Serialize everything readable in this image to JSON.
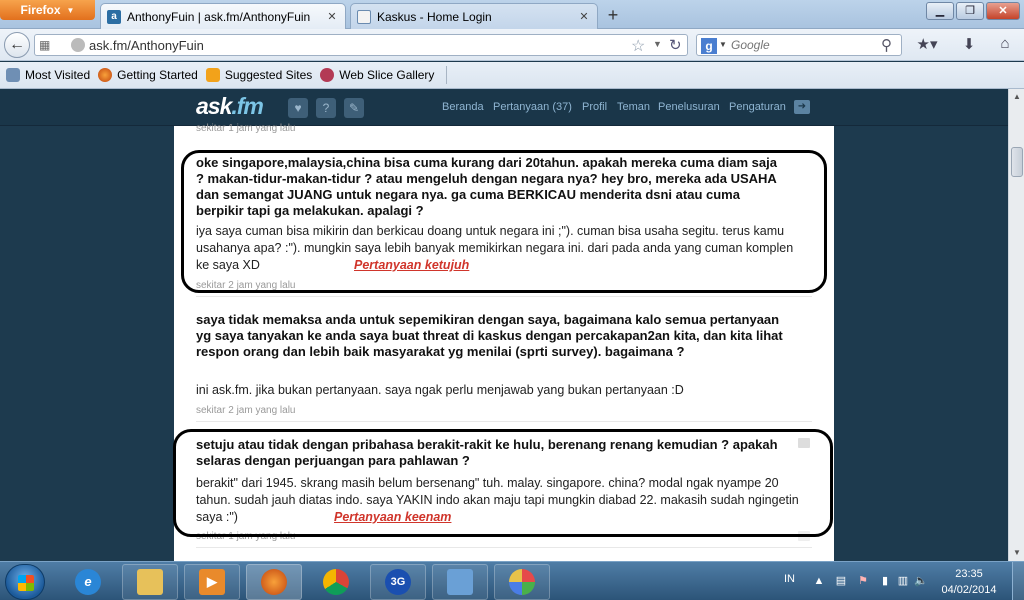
{
  "browser": {
    "menu_button": "Firefox",
    "tabs": [
      {
        "label": "AnthonyFuin | ask.fm/AnthonyFuin",
        "favicon": "askfm-icon",
        "active": true
      },
      {
        "label": "Kaskus - Home Login",
        "favicon": "kaskus-icon",
        "active": false
      }
    ],
    "url": "ask.fm/AnthonyFuin",
    "search_placeholder": "Google",
    "bookmarks": [
      {
        "label": "Most Visited"
      },
      {
        "label": "Getting Started"
      },
      {
        "label": "Suggested Sites"
      },
      {
        "label": "Web Slice Gallery"
      }
    ]
  },
  "askfm": {
    "logo_main": "ask",
    "logo_dot": ".fm",
    "menu": [
      "Beranda",
      "Pertanyaan (37)",
      "Profil",
      "Teman",
      "Penelusuran",
      "Pengaturan"
    ],
    "top_ago": "sekitar 1 jam yang lalu",
    "posts": [
      {
        "question": "oke singapore,malaysia,china bisa cuma kurang dari 20tahun. apakah mereka cuma diam saja ? makan-tidur-makan-tidur ? atau mengeluh dengan negara nya? hey bro, mereka ada USAHA dan semangat JUANG untuk negara nya. ga cuma BERKICAU menderita dsni atau cuma berpikir tapi ga melakukan. apalagi ?",
        "answer": "iya saya cuman bisa mikirin dan berkicau doang untuk negara ini ;\"). cuman bisa usaha segitu. terus kamu usahanya apa? :\"). mungkin saya lebih banyak memikirkan negara ini. dari pada anda yang cuman komplen ke saya XD",
        "ago": "sekitar 2 jam yang lalu",
        "annotation": "Pertanyaan ketujuh"
      },
      {
        "question": "saya tidak memaksa anda untuk sepemikiran dengan saya, bagaimana kalo semua pertanyaan yg saya tanyakan ke anda saya buat threat di kaskus dengan percakapan2an kita, dan kita lihat respon orang dan lebih baik masyarakat yg menilai (sprti survey). bagaimana ?",
        "answer": "ini ask.fm. jika bukan pertanyaan. saya ngak perlu menjawab yang bukan pertanyaan :D",
        "ago": "sekitar 2 jam yang lalu"
      },
      {
        "question": "setuju atau tidak dengan pribahasa berakit-rakit ke hulu, berenang renang kemudian ? apakah selaras dengan perjuangan para pahlawan ?",
        "answer": "berakit\" dari 1945. skrang masih belum bersenang\" tuh. malay. singapore. china? modal ngak nyampe 20 tahun. sudah jauh diatas indo. saya YAKIN indo akan maju tapi mungkin diabad 22. makasih sudah ngingetin saya :\")",
        "ago": "sekitar 1 jam yang lalu",
        "annotation": "Pertanyaan keenam"
      }
    ],
    "annotation_color": "#d0352b"
  },
  "taskbar": {
    "apps": [
      "internet-explorer-icon",
      "file-explorer-icon",
      "media-player-icon",
      "firefox-icon",
      "chrome-icon",
      "3g-modem-icon",
      "control-panel-icon",
      "paint-icon"
    ],
    "badge_3g": "3G",
    "language": "IN",
    "time": "23:35",
    "date": "04/02/2014"
  }
}
